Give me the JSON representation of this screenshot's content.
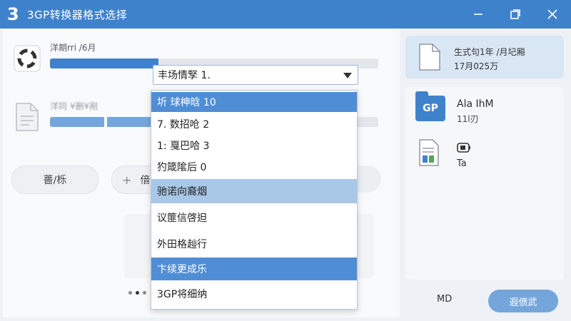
{
  "window": {
    "logo": "3",
    "title": "3GP转换器格式选择",
    "controls": [
      "minimize-icon",
      "restore-icon",
      "close-icon"
    ]
  },
  "files": [
    {
      "name": "洋期rri /6月",
      "icon": "lifebuoy-icon",
      "progress": 0.33
    },
    {
      "name": "洋同 ¥删¥剐",
      "icon": "document-icon",
      "progress": 0.5
    }
  ],
  "buttons": {
    "settings": "薔/栎",
    "add_prefix": "+",
    "add_label": "偣"
  },
  "select": {
    "current": "丰场情孯 1.",
    "options": [
      {
        "label": "圻 球柛晗 10",
        "state": "selected"
      },
      {
        "label": "7. 数招呛 2",
        "state": "normal"
      },
      {
        "label": "1: 戛巴哈 3",
        "state": "normal"
      },
      {
        "label": "犳箴隂后 0",
        "state": "normal"
      },
      {
        "label": "驰诺向裔烟",
        "state": "highlighted"
      },
      {
        "label": "议篚信啓𨑨",
        "state": "normal"
      },
      {
        "label": "外田格赸行",
        "state": "normal"
      },
      {
        "label": "卞续更成乐",
        "state": "selected"
      },
      {
        "label": "3GP将细纳",
        "state": "normal"
      }
    ]
  },
  "summary": {
    "line1": "生式句1年 /月圮厢",
    "line2": "17月025万"
  },
  "format": {
    "icon_text": "GP",
    "name": "Ala IhM",
    "size": "11l刃",
    "codec_label": "Ta"
  },
  "footer": {
    "md_label": "MD",
    "convert_label": "遐偾武"
  },
  "colors": {
    "accent": "#3f82cc",
    "selected": "#4f8ed4",
    "highlight": "#a9c8e8"
  }
}
